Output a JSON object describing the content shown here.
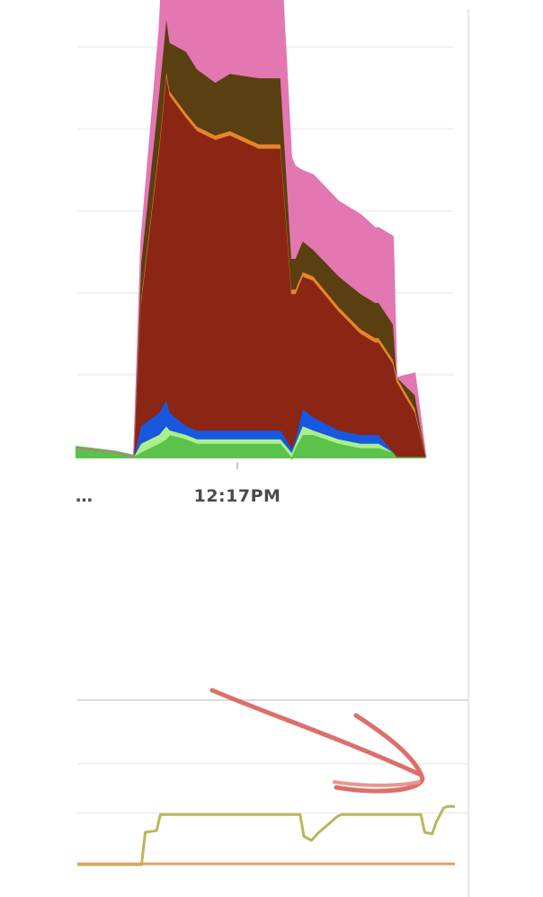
{
  "chart_data": [
    {
      "type": "area",
      "stacked": true,
      "grid": true,
      "x_ticks": [
        {
          "label": "12:17PM",
          "t": 0.44
        },
        {
          "label": "…",
          "t": 0.0
        }
      ],
      "x": [
        0.0,
        0.1,
        0.155,
        0.175,
        0.225,
        0.245,
        0.255,
        0.3,
        0.33,
        0.38,
        0.42,
        0.5,
        0.56,
        0.59,
        0.6,
        0.62,
        0.65,
        0.72,
        0.78,
        0.82,
        0.83,
        0.87,
        0.88,
        0.93,
        0.96
      ],
      "y_range": [
        0,
        100
      ],
      "series": [
        {
          "color": "#5bc24a",
          "values": [
            2,
            1,
            0,
            1,
            3,
            4,
            5,
            4,
            3,
            3,
            3,
            3,
            3,
            0,
            2,
            5,
            5,
            3,
            2,
            2,
            2,
            1,
            0,
            0,
            0
          ]
        },
        {
          "color": "#a9f08c",
          "values": [
            0,
            0,
            0,
            2,
            2,
            3,
            1,
            1,
            1,
            1,
            1,
            1,
            1,
            1,
            1,
            2,
            1,
            1,
            1,
            1,
            1,
            0,
            0,
            0,
            0
          ]
        },
        {
          "color": "#1858e0",
          "values": [
            0,
            0,
            0,
            4,
            5,
            6,
            4,
            2,
            2,
            2,
            2,
            2,
            2,
            1,
            1,
            4,
            3,
            2,
            2,
            2,
            2,
            0,
            0,
            0,
            0
          ]
        },
        {
          "color": "#8b2514",
          "values": [
            0,
            0,
            0,
            28,
            60,
            74,
            72,
            70,
            68,
            66,
            67,
            64,
            64,
            35,
            33,
            30,
            31,
            27,
            23,
            21,
            21,
            20,
            17,
            10,
            0
          ]
        },
        {
          "color": "#e7842c",
          "values": [
            0,
            0,
            0,
            1,
            1,
            1,
            1,
            1,
            1,
            1,
            1,
            1,
            1,
            1,
            1,
            1,
            1,
            1,
            1,
            1,
            1,
            1,
            1,
            1,
            0
          ]
        },
        {
          "color": "#5a3f10",
          "values": [
            0,
            0,
            0,
            8,
            12,
            12,
            11,
            14,
            13,
            12,
            13,
            15,
            15,
            7,
            7,
            7,
            6,
            7,
            8,
            8,
            8,
            8,
            0,
            3,
            0
          ]
        },
        {
          "color": "#e277b2",
          "values": [
            0,
            0,
            0,
            5,
            14,
            30,
            31,
            28,
            28,
            27,
            26,
            29,
            29,
            23,
            21,
            16,
            17,
            17,
            18,
            17,
            17,
            20,
            0,
            5,
            0
          ]
        }
      ]
    },
    {
      "type": "line",
      "grid": true,
      "x": [
        0.0,
        0.17,
        0.18,
        0.21,
        0.22,
        0.59,
        0.6,
        0.62,
        0.64,
        0.69,
        0.7,
        0.74,
        0.91,
        0.92,
        0.94,
        0.95,
        0.97,
        0.98,
        1.0
      ],
      "y_range": [
        0,
        100
      ],
      "series": [
        {
          "color": "#b9b65c",
          "values": [
            0,
            0,
            40,
            42,
            62,
            62,
            35,
            30,
            40,
            60,
            62,
            62,
            62,
            40,
            38,
            52,
            70,
            72,
            72
          ]
        },
        {
          "color": "#e1a060",
          "values": [
            1,
            1,
            1,
            1,
            1,
            1,
            1,
            1,
            1,
            1,
            1,
            1,
            1,
            1,
            1,
            1,
            1,
            1,
            1
          ]
        }
      ]
    }
  ]
}
